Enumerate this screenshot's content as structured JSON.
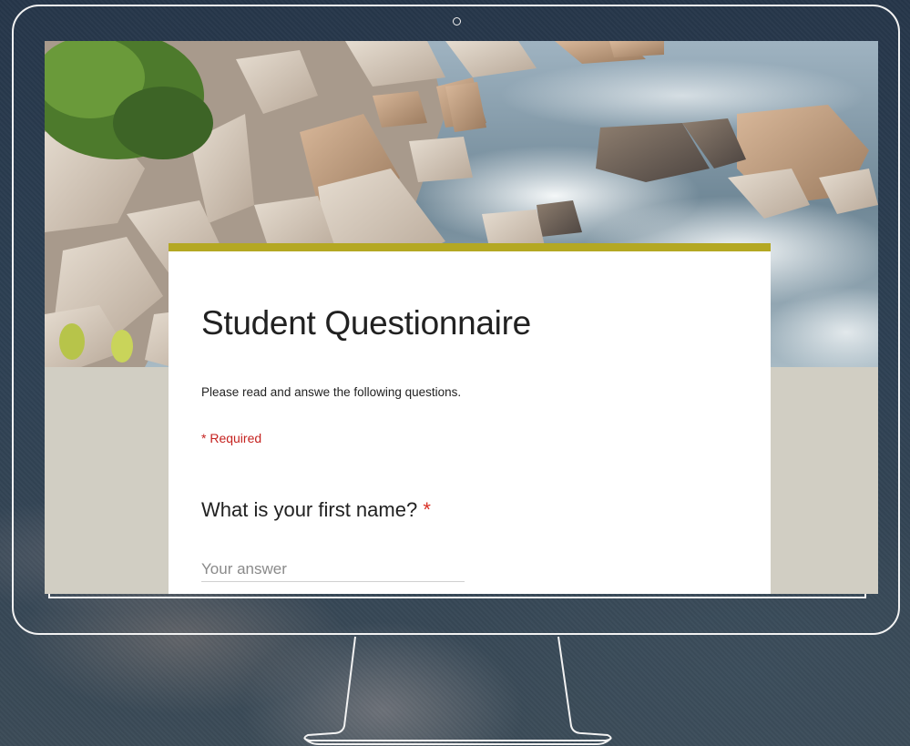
{
  "form": {
    "title": "Student Questionnaire",
    "description": "Please read and answe the following questions.",
    "required_note": "* Required",
    "question": {
      "label": "What is your first name?",
      "required_mark": "*",
      "placeholder": "Your answer",
      "value": ""
    }
  },
  "theme": {
    "accent": "#b4a823",
    "background": "#d1cec3",
    "required_color": "#c5221f"
  }
}
